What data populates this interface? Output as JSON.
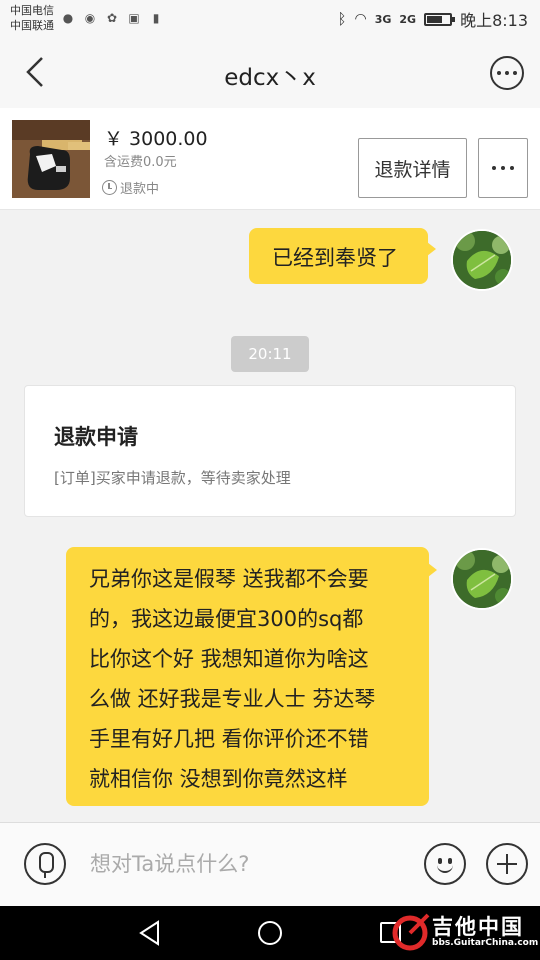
{
  "status_bar": {
    "carrier_1": "中国电信",
    "carrier_2": "中国联通",
    "network_1": "3G",
    "network_2": "2G",
    "time": "晚上8:13",
    "battery_level": 0.7
  },
  "nav": {
    "title": "edcx丶x"
  },
  "product": {
    "price": "￥ 3000.00",
    "shipping": "含运费0.0元",
    "status": "退款中",
    "refund_detail_label": "退款详情"
  },
  "chat": {
    "messages": [
      {
        "sender": "me",
        "text": "已经到奉贤了"
      },
      {
        "sender": "me",
        "lines": [
          "兄弟你这是假琴 送我都不会要",
          "的，我这边最便宜300的sq都",
          "比你这个好 我想知道你为啥这",
          "么做 还好我是专业人士 芬达琴",
          "手里有好几把 看你评价还不错",
          "就相信你 没想到你竟然这样"
        ]
      }
    ],
    "timestamp": "20:11",
    "refund_card": {
      "title": "退款申请",
      "description": "[订单]买家申请退款，等待卖家处理"
    }
  },
  "input": {
    "placeholder": "想对Ta说点什么?"
  },
  "watermark": {
    "title": "吉他中国",
    "subtitle": "bbs.GuitarChina.com"
  },
  "colors": {
    "bubble": "#fdd83e",
    "background": "#f2f2f2",
    "timestamp_chip": "#cccccc"
  }
}
